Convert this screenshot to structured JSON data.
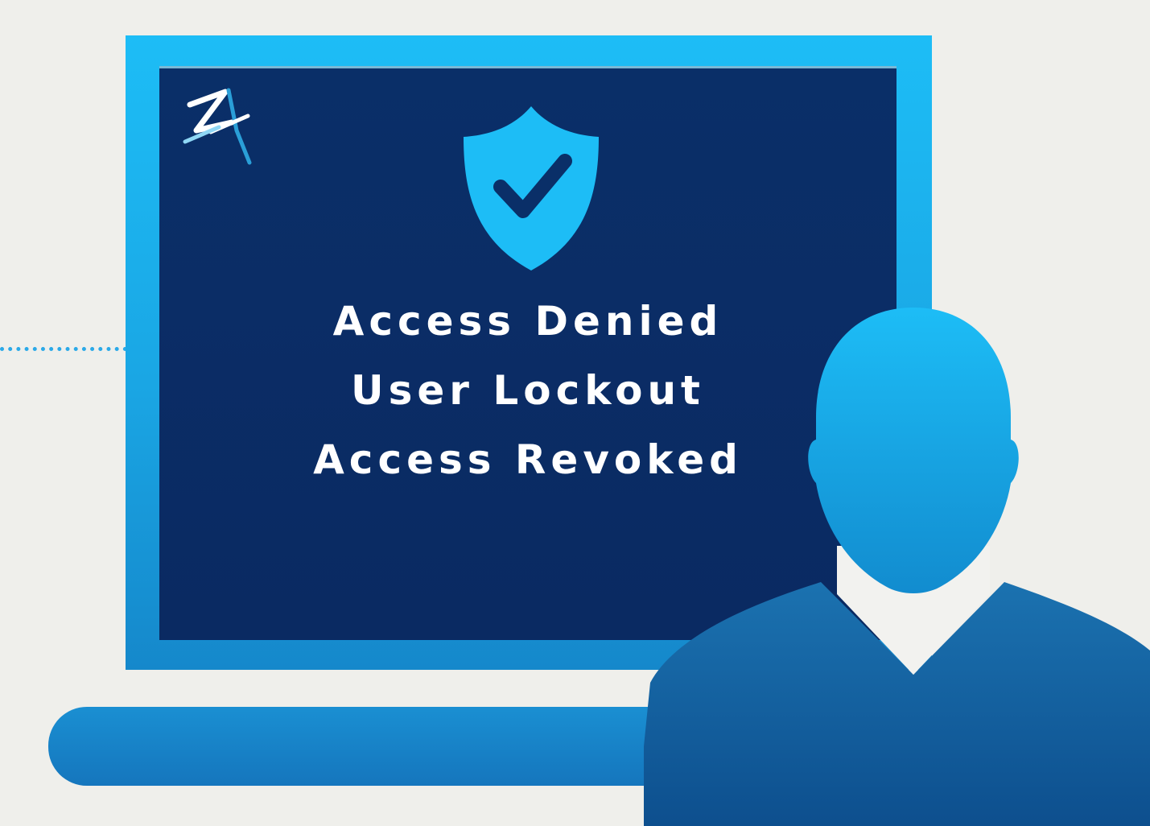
{
  "screen": {
    "status_lines": [
      "Access Denied",
      "User Lockout",
      "Access Revoked"
    ]
  },
  "icons": {
    "logo": "z-logo-mark",
    "shield": "shield-check-icon",
    "user": "user-silhouette-icon"
  },
  "colors": {
    "background": "#efefeb",
    "frame_accent": "#1dbdf6",
    "screen_dark": "#0a2f68",
    "text": "#ffffff"
  }
}
